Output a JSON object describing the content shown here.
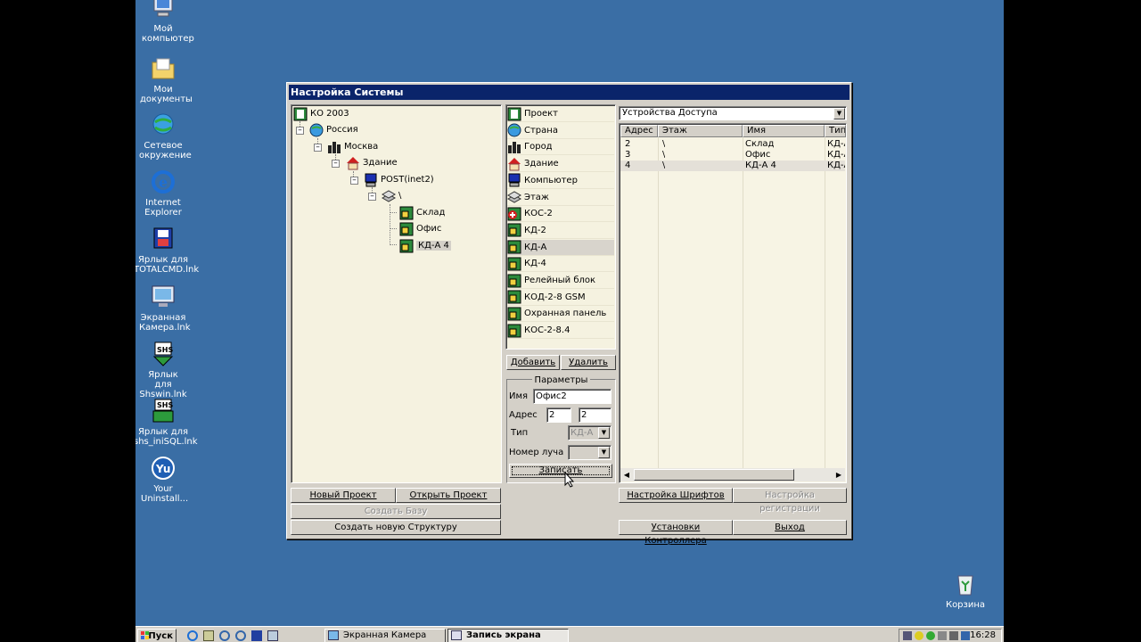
{
  "desktop": {
    "icons": [
      {
        "label": "Мой компьютер",
        "icon": "my-computer-icon"
      },
      {
        "label": "Мои документы",
        "icon": "my-documents-icon"
      },
      {
        "label": "Сетевое окружение",
        "icon": "network-icon"
      },
      {
        "label": "Internet Explorer",
        "icon": "internet-explorer-icon"
      },
      {
        "label": "Ярлык для TOTALCMD.lnk",
        "icon": "totalcmd-icon"
      },
      {
        "label": "Экранная Камера.lnk",
        "icon": "screen-camera-icon"
      },
      {
        "label": "Ярлык для Shswin.lnk",
        "icon": "shswin-icon"
      },
      {
        "label": "Ярлык для shs_iniSQL.lnk",
        "icon": "shs-inisql-icon"
      },
      {
        "label": "Your Uninstall...",
        "icon": "your-uninstaller-icon"
      }
    ],
    "recycle_bin": "Корзина"
  },
  "window": {
    "title": "Настройка Системы",
    "tree": {
      "root": "КО 2003",
      "country": "Россия",
      "city": "Москва",
      "building": "Здание",
      "computer": "POST(inet2)",
      "floor": "\\",
      "devices": [
        "Склад",
        "Офис",
        "КД-А 4"
      ],
      "selected": "КД-А 4"
    },
    "types": [
      {
        "label": "Проект",
        "icon": "project-icon"
      },
      {
        "label": "Страна",
        "icon": "globe-icon"
      },
      {
        "label": "Город",
        "icon": "city-icon"
      },
      {
        "label": "Здание",
        "icon": "house-icon"
      },
      {
        "label": "Компьютер",
        "icon": "computer-icon"
      },
      {
        "label": "Этаж",
        "icon": "floor-icon"
      },
      {
        "label": "КОС-2",
        "icon": "kos2-icon"
      },
      {
        "label": "КД-2",
        "icon": "device-board-icon"
      },
      {
        "label": "КД-А",
        "icon": "device-board-icon"
      },
      {
        "label": "КД-4",
        "icon": "device-board-icon"
      },
      {
        "label": "Релейный блок",
        "icon": "device-board-icon"
      },
      {
        "label": "КОД-2-8 GSM",
        "icon": "device-board-icon"
      },
      {
        "label": "Охранная панель",
        "icon": "device-board-icon"
      },
      {
        "label": "КОС-2-8.4",
        "icon": "device-board-icon"
      }
    ],
    "selected_type": "КД-А",
    "buttons": {
      "add": "Добавить",
      "delete": "Удалить",
      "save": "Записать",
      "new_project": "Новый Проект",
      "open_project": "Открыть Проект",
      "create_db": "Создать Базу",
      "create_structure": "Создать новую Структуру",
      "font_settings": "Настройка Шрифтов",
      "registration_settings": "Настройка регистрации",
      "controller_settings": "Установки Контроллера",
      "exit": "Выход"
    },
    "params": {
      "title": "Параметры",
      "name_label": "Имя",
      "name_value": "Офис2",
      "address_label": "Адрес",
      "address_value_1": "2",
      "address_value_2": "2",
      "type_label": "Тип",
      "type_value": "КД-А",
      "ray_label": "Номер луча",
      "ray_value": ""
    },
    "device_combo": "Устройства Доступа",
    "grid": {
      "columns": [
        "Адрес",
        "Этаж",
        "Имя",
        "Тип"
      ],
      "rows": [
        [
          "2",
          "\\",
          "Склад",
          "КД-А"
        ],
        [
          "3",
          "\\",
          "Офис",
          "КД-А"
        ],
        [
          "4",
          "\\",
          "КД-А 4",
          "КД-А"
        ]
      ],
      "selected_row": 2
    }
  },
  "taskbar": {
    "start": "Пуск",
    "tasks": [
      {
        "label": "Экранная Камера",
        "active": false
      },
      {
        "label": "Запись экрана",
        "active": true
      }
    ],
    "clock": "16:28"
  }
}
